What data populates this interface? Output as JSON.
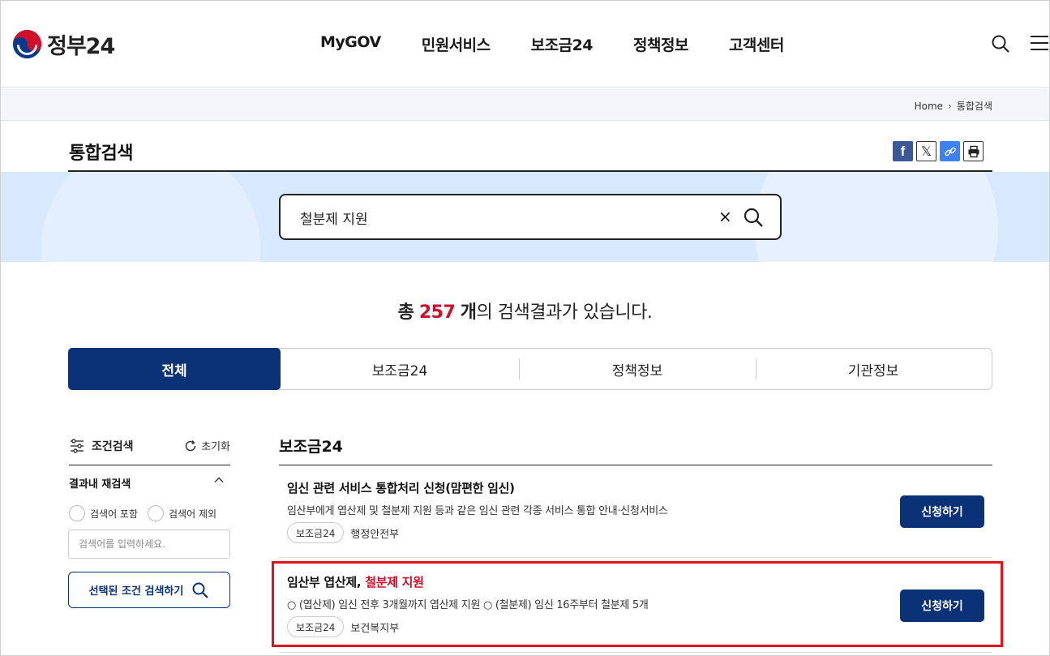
{
  "header": {
    "logo_text": "정부24",
    "nav": [
      "MyGOV",
      "민원서비스",
      "보조금24",
      "정책정보",
      "고객센터"
    ]
  },
  "breadcrumb": {
    "home": "Home",
    "current": "통합검색"
  },
  "page": {
    "title": "통합검색"
  },
  "share": {
    "facebook": "f",
    "x": "𝕏"
  },
  "search": {
    "value": "철분제 지원",
    "clear": "×"
  },
  "summary": {
    "prefix": "총",
    "count": "257",
    "unit": "개",
    "suffix": "의 검색결과가 있습니다."
  },
  "tabs": [
    {
      "label": "전체",
      "active": true
    },
    {
      "label": "보조금24",
      "active": false
    },
    {
      "label": "정책정보",
      "active": false
    },
    {
      "label": "기관정보",
      "active": false
    }
  ],
  "filter": {
    "title": "조건검색",
    "reset": "초기화",
    "research_title": "결과내 재검색",
    "include_label": "검색어 포함",
    "exclude_label": "검색어 제외",
    "keyword_placeholder": "검색어를 입력하세요.",
    "search_button": "선택된 조건 검색하기"
  },
  "results": {
    "section_title": "보조금24",
    "items": [
      {
        "title": "임신 관련 서비스 통합처리 신청(맘편한 임신)",
        "desc": "임산부에게 엽산제 및 철분제 지원 등과 같은 임신 관련 각종 서비스 통합 안내·신청서비스",
        "tag": "보조금24",
        "agency": "행정안전부",
        "button": "신청하기"
      },
      {
        "title_plain": "임산부 엽산제, ",
        "title_highlight": "철분제 지원",
        "desc": "○ (엽산제) 임신 전후 3개월까지 엽산제 지원 ○ (철분제) 임신 16주부터 철분제 5개",
        "tag": "보조금24",
        "agency": "보건복지부",
        "button": "신청하기"
      }
    ]
  },
  "colors": {
    "primary": "#0b3176",
    "highlight": "#d0102b",
    "band": "#d9e9fd"
  }
}
